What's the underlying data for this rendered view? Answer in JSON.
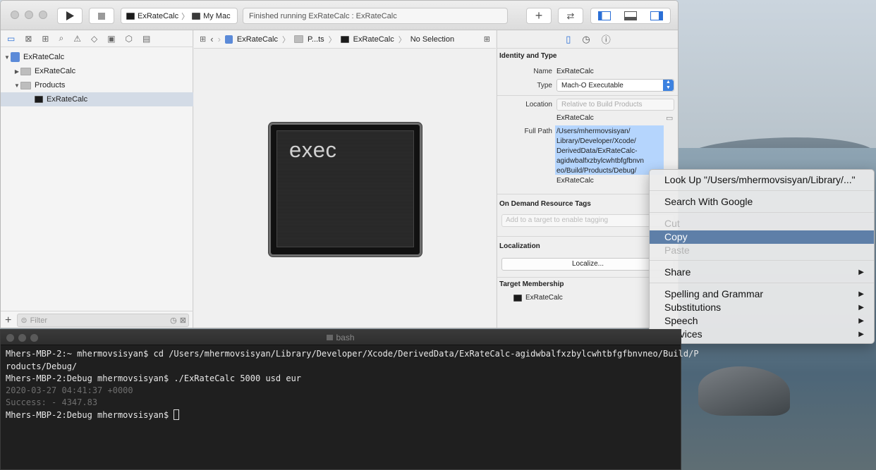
{
  "toolbar": {
    "scheme_name": "ExRateCalc",
    "destination": "My Mac",
    "status": "Finished running ExRateCalc : ExRateCalc"
  },
  "navigator": {
    "items": [
      {
        "label": "ExRateCalc"
      },
      {
        "label": "ExRateCalc"
      },
      {
        "label": "Products"
      },
      {
        "label": "ExRateCalc"
      }
    ],
    "filter_placeholder": "Filter"
  },
  "jumpbar": {
    "project": "ExRateCalc",
    "group": "P...ts",
    "file": "ExRateCalc",
    "selection": "No Selection"
  },
  "editor": {
    "icon_text": "exec"
  },
  "inspector": {
    "identity_title": "Identity and Type",
    "name_label": "Name",
    "name_value": "ExRateCalc",
    "type_label": "Type",
    "type_value": "Mach-O Executable",
    "location_label": "Location",
    "location_value": "Relative to Build Products",
    "location_file": "ExRateCalc",
    "fullpath_label": "Full Path",
    "fullpath_lines": [
      "/Users/mhermovsisyan/",
      "Library/Developer/Xcode/",
      "DerivedData/ExRateCalc-",
      "agidwbalfxzbylcwhtbfgfbnvn",
      "eo/Build/Products/Debug/",
      "ExRateCalc"
    ],
    "tags_title": "On Demand Resource Tags",
    "tags_placeholder": "Add to a target to enable tagging",
    "localization_title": "Localization",
    "localize_button": "Localize...",
    "membership_title": "Target Membership",
    "membership_target": "ExRateCalc"
  },
  "context_menu": {
    "lookup": "Look Up \"/Users/mhermovsisyan/Library/...\"",
    "search": "Search With Google",
    "cut": "Cut",
    "copy": "Copy",
    "paste": "Paste",
    "share": "Share",
    "spelling": "Spelling and Grammar",
    "substitutions": "Substitutions",
    "speech": "Speech",
    "services": "Services"
  },
  "terminal": {
    "title": "bash",
    "lines": [
      "Mhers-MBP-2:~ mhermovsisyan$ cd /Users/mhermovsisyan/Library/Developer/Xcode/DerivedData/ExRateCalc-agidwbalfxzbylcwhtbfgfbnvneo/Build/P",
      "roducts/Debug/",
      "Mhers-MBP-2:Debug mhermovsisyan$ ./ExRateCalc 5000 usd eur",
      "2020-03-27 04:41:37 +0000",
      "Success: - 4347.83",
      "Mhers-MBP-2:Debug mhermovsisyan$ "
    ]
  }
}
